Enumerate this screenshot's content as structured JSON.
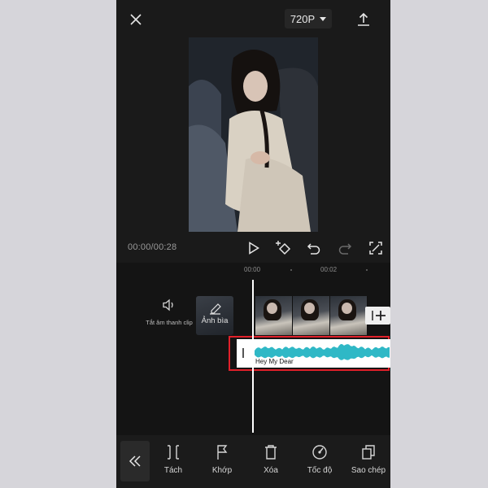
{
  "topbar": {
    "resolution": "720P"
  },
  "player": {
    "timecode": "00:00/00:28"
  },
  "ruler": {
    "labels": [
      "00:00",
      "00:02"
    ]
  },
  "track_controls": {
    "mute_label": "Tắt âm thanh clip",
    "cover_label": "Ảnh bìa"
  },
  "audio": {
    "title": "Hey My Dear",
    "color": "#2fb8c6"
  },
  "highlight_color": "#e0202a",
  "toolbar": {
    "items": [
      {
        "label": "Tách",
        "icon": "split-icon"
      },
      {
        "label": "Khớp",
        "icon": "flag-icon"
      },
      {
        "label": "Xóa",
        "icon": "trash-icon"
      },
      {
        "label": "Tốc độ",
        "icon": "speed-icon"
      },
      {
        "label": "Sao chép",
        "icon": "copy-icon"
      }
    ]
  }
}
